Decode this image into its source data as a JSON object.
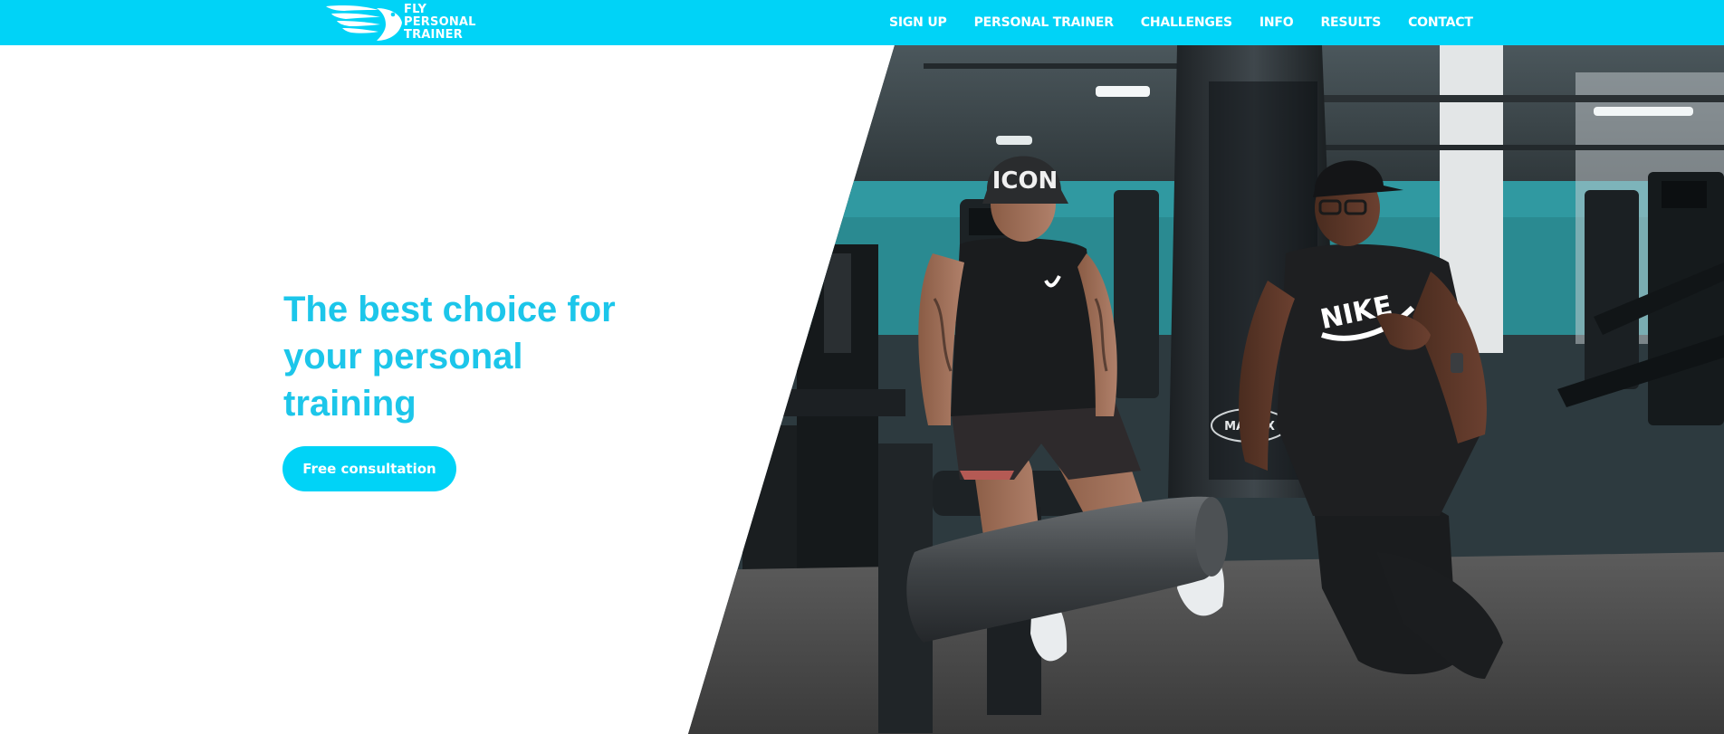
{
  "brand": {
    "logo_icon": "wing-icon",
    "name_lines": [
      "FLY",
      "PERSONAL",
      "TRAINER"
    ],
    "accent_color": "#00d3f7",
    "title_color": "#1cc6ea"
  },
  "nav": {
    "items": [
      {
        "label": "SIGN UP"
      },
      {
        "label": "PERSONAL TRAINER"
      },
      {
        "label": "CHALLENGES"
      },
      {
        "label": "INFO"
      },
      {
        "label": "RESULTS"
      },
      {
        "label": "CONTACT"
      }
    ]
  },
  "hero": {
    "title": "The best choice for your personal training",
    "cta_label": "Free consultation",
    "image": {
      "cap_text": "ICON",
      "machine_text": "MATRIX",
      "shirt_text": "NIKE"
    }
  }
}
